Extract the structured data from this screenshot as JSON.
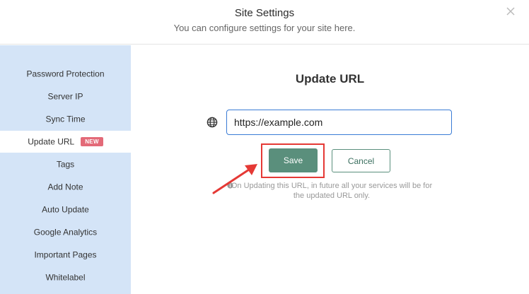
{
  "header": {
    "title": "Site Settings",
    "subtitle": "You can configure settings for your site here."
  },
  "sidebar": {
    "items": [
      {
        "label": "Password Protection"
      },
      {
        "label": "Server IP"
      },
      {
        "label": "Sync Time"
      },
      {
        "label": "Update URL",
        "badge": "NEW",
        "active": true
      },
      {
        "label": "Tags"
      },
      {
        "label": "Add Note"
      },
      {
        "label": "Auto Update"
      },
      {
        "label": "Google Analytics"
      },
      {
        "label": "Important Pages"
      },
      {
        "label": "Whitelabel"
      }
    ]
  },
  "main": {
    "title": "Update URL",
    "url_input": {
      "value": "https://example.com"
    },
    "save_label": "Save",
    "cancel_label": "Cancel",
    "note": "On Updating this URL, in future all your services will be for the updated URL only."
  },
  "icons": {
    "close": "close-icon",
    "globe": "globe-icon",
    "info": "info-icon"
  },
  "colors": {
    "sidebar_bg": "#d4e4f7",
    "badge": "#e36a78",
    "primary_button": "#5a8f7c",
    "input_border": "#3a7bd5",
    "annotation": "#e53935"
  }
}
